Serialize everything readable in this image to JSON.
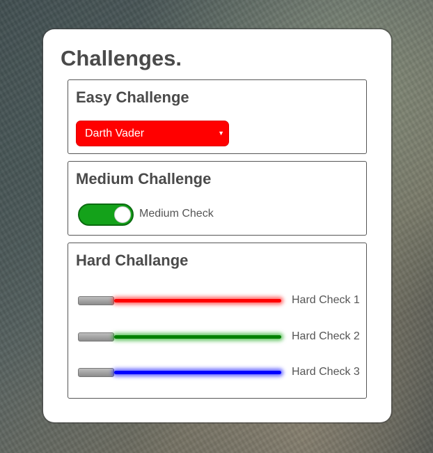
{
  "card": {
    "title": "Challenges."
  },
  "easy": {
    "title": "Easy Challenge",
    "select_value": "Darth Vader",
    "select_arrow_icon": "caret-down-icon",
    "select_color": "#ff0000"
  },
  "medium": {
    "title": "Medium Challenge",
    "toggle_on": true,
    "toggle_color": "#14a21a",
    "check_label": "Medium Check"
  },
  "hard": {
    "title": "Hard Challange",
    "sabers": [
      {
        "label": "Hard Check 1",
        "color": "#ff0000",
        "glow": "rgba(255,0,0,0.6)"
      },
      {
        "label": "Hard Check 2",
        "color": "#008000",
        "glow": "rgba(0,160,0,0.6)"
      },
      {
        "label": "Hard Check 3",
        "color": "#0000ff",
        "glow": "rgba(0,0,255,0.6)"
      }
    ]
  }
}
